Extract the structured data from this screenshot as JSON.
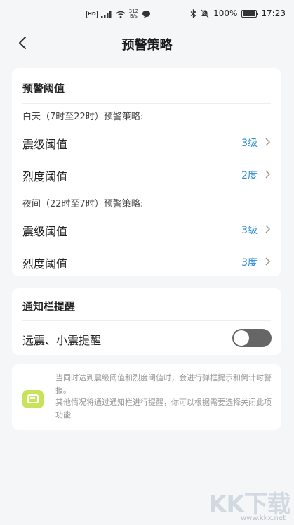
{
  "status_bar": {
    "hd": "HD",
    "net_speed_value": "312",
    "net_speed_unit": "B/s",
    "battery_percent": "100%",
    "battery_level": 1.0,
    "time": "17:23"
  },
  "header": {
    "title": "预警策略"
  },
  "threshold_card": {
    "title": "预警阈值",
    "day_heading": "白天（7时至22时）预警策略:",
    "day_rows": [
      {
        "label": "震级阈值",
        "value": "3级"
      },
      {
        "label": "烈度阈值",
        "value": "2度"
      }
    ],
    "night_heading": "夜间（22时至7时）预警策略:",
    "night_rows": [
      {
        "label": "震级阈值",
        "value": "3级"
      },
      {
        "label": "烈度阈值",
        "value": "3度"
      }
    ]
  },
  "notify_card": {
    "title": "通知栏提醒",
    "toggle_label": "远震、小震提醒",
    "toggle_on": false
  },
  "info_box": {
    "icon": "notice-icon",
    "line1": "当同时达到震级阈值和烈度阈值时，会进行弹框提示和倒计时警报。",
    "line2": "其他情况将通过通知栏进行提醒，你可以根据需要选择关闭此项功能"
  },
  "watermark": {
    "logo": "KK下载",
    "url": "www.kkx.net"
  }
}
